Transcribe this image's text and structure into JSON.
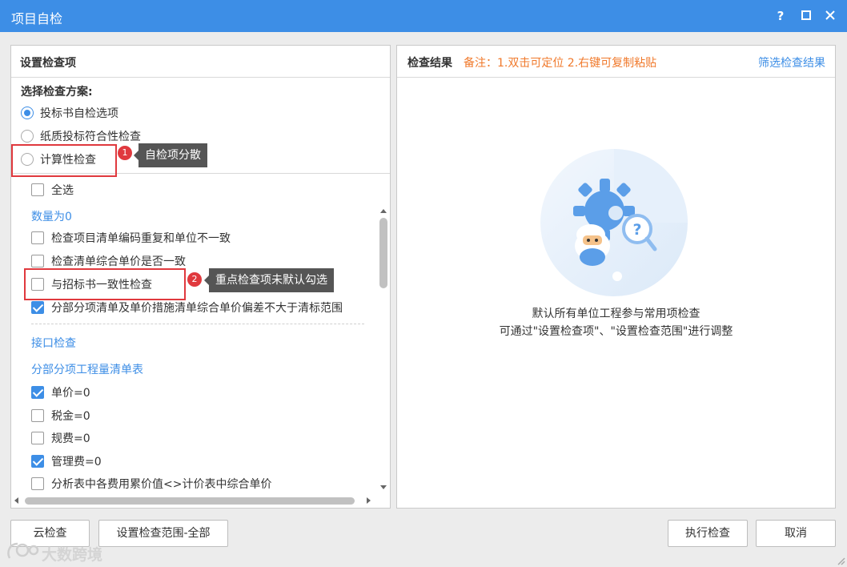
{
  "window": {
    "title": "项目自检",
    "help_label": "?",
    "maximize_label": "□",
    "close_label": "✕"
  },
  "left_panel": {
    "title": "设置检查项",
    "scheme_label": "选择检查方案:",
    "schemes": [
      {
        "label": "投标书自检选项",
        "selected": true
      },
      {
        "label": "纸质投标符合性检查",
        "selected": false
      },
      {
        "label": "计算性检查",
        "selected": false
      }
    ],
    "select_all": "全选",
    "group_quantity_zero": "数量为0",
    "items_a": [
      {
        "label": "检查项目清单编码重复和单位不一致",
        "checked": false
      },
      {
        "label": "检查清单综合单价是否一致",
        "checked": false
      },
      {
        "label": "与招标书一致性检查",
        "checked": false
      },
      {
        "label": "分部分项清单及单价措施清单综合单价偏差不大于清标范围",
        "checked": true
      }
    ],
    "group_interface": "接口检查",
    "group_bill": "分部分项工程量清单表",
    "items_b": [
      {
        "label": "单价=0",
        "checked": true
      },
      {
        "label": "税金=0",
        "checked": false
      },
      {
        "label": "规费=0",
        "checked": false
      },
      {
        "label": "管理费=0",
        "checked": true
      },
      {
        "label": "分析表中各费用累价值<>计价表中综合单价",
        "checked": false
      }
    ]
  },
  "annotations": {
    "badge1": "1",
    "tip1": "自检项分散",
    "badge2": "2",
    "tip2": "重点检查项未默认勾选"
  },
  "right_panel": {
    "title": "检查结果",
    "note": "备注：1.双击可定位 2.右键可复制粘贴",
    "filter_link": "筛选检查结果",
    "empty_line1": "默认所有单位工程参与常用项检查",
    "empty_line2": "可通过\"设置检查项\"、\"设置检查范围\"进行调整"
  },
  "footer": {
    "cloud_check": "云检查",
    "set_range": "设置检查范围-全部",
    "run_check": "执行检查",
    "cancel": "取消"
  },
  "watermark": "大数跨境",
  "colors": {
    "accent": "#3d8ee6",
    "note_orange": "#f0792b",
    "annotation_red": "#e0393e"
  }
}
